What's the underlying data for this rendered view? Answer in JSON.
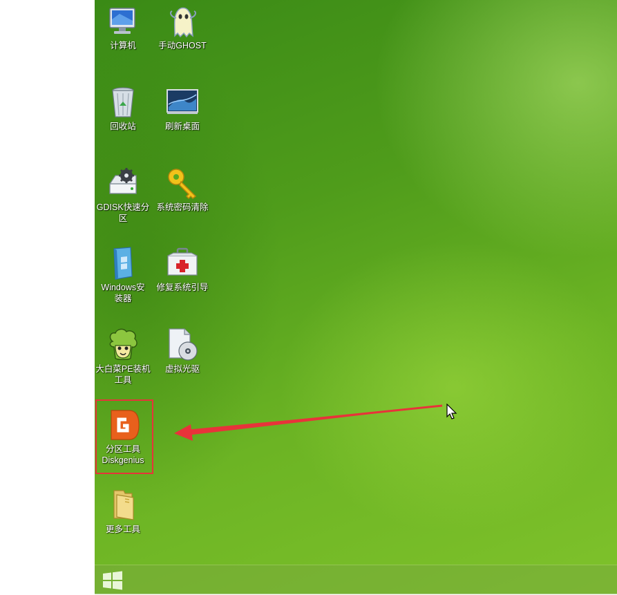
{
  "desktop_icons": [
    {
      "label": "计算机",
      "icon": "computer-icon"
    },
    {
      "label": "手动GHOST",
      "icon": "ghost-icon"
    },
    {
      "label": "回收站",
      "icon": "recycle-bin-icon"
    },
    {
      "label": "刷新桌面",
      "icon": "refresh-desktop-icon"
    },
    {
      "label_line1": "GDISK快速分",
      "label_line2": "区",
      "icon": "gdisk-icon"
    },
    {
      "label": "系统密码清除",
      "icon": "key-icon"
    },
    {
      "label_line1": "Windows安",
      "label_line2": "装器",
      "icon": "windows-installer-icon"
    },
    {
      "label": "修复系统引导",
      "icon": "first-aid-kit-icon"
    },
    {
      "label_line1": "大白菜PE装机",
      "label_line2": "工具",
      "icon": "cabbage-mascot-icon"
    },
    {
      "label": "虚拟光驱",
      "icon": "virtual-drive-icon"
    },
    {
      "label_line1": "分区工具",
      "label_line2": "Diskgenius",
      "icon": "diskgenius-icon"
    },
    {
      "label": "更多工具",
      "icon": "folder-icon"
    }
  ],
  "annotation": {
    "highlight_color": "#e8333a",
    "arrow_color": "#e8333a"
  },
  "taskbar": {
    "start_icon": "windows-start-icon"
  },
  "colors": {
    "desktop_green": "#5aa81f",
    "diskgenius_orange": "#e8601c"
  }
}
